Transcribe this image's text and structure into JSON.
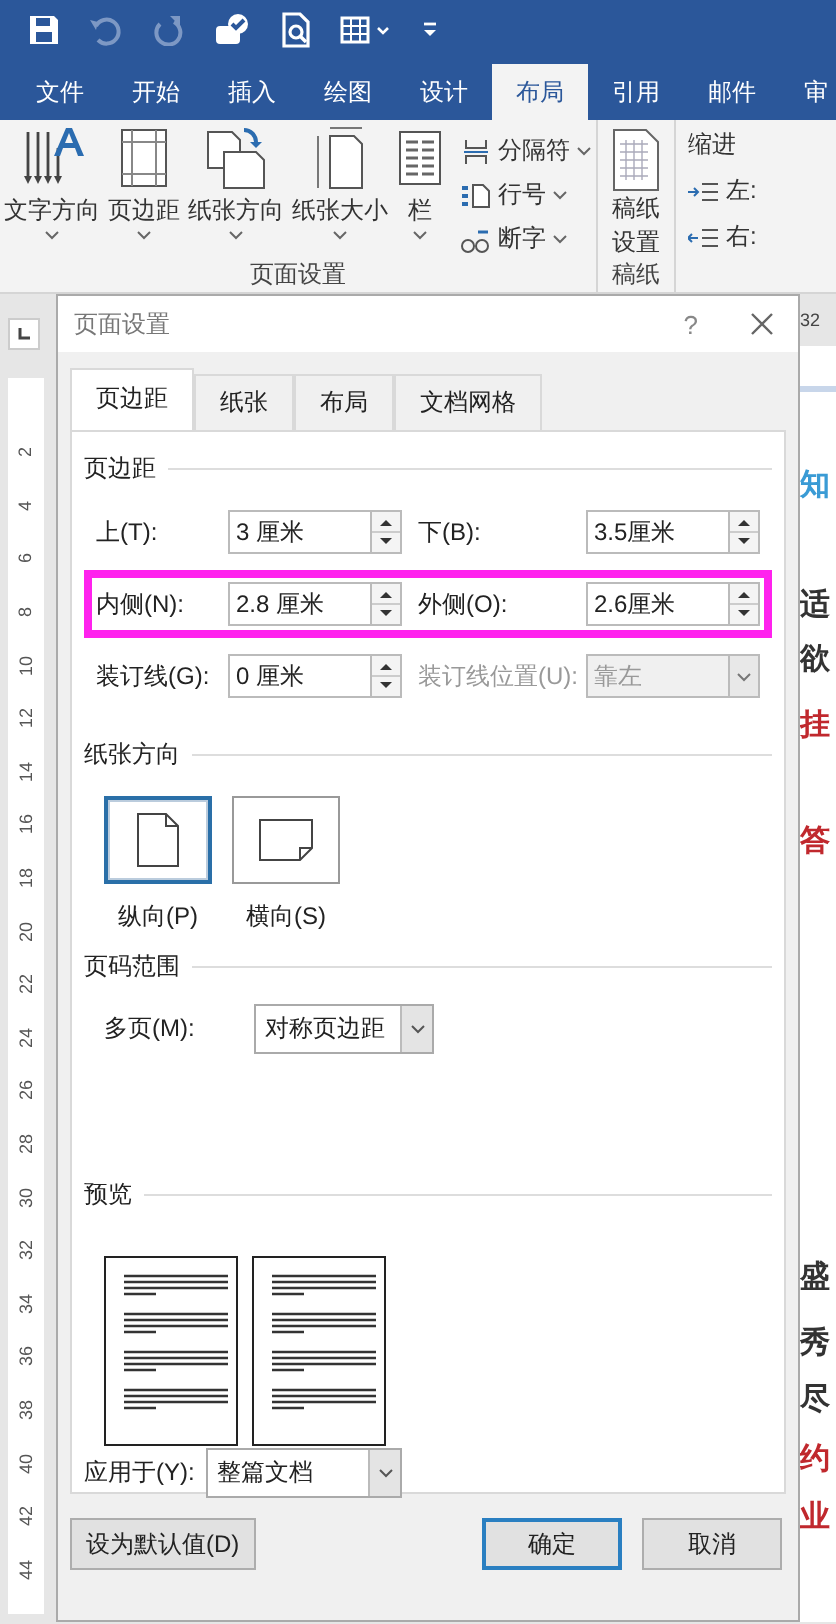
{
  "quick_access": [
    {
      "kind": "save",
      "disabled": false
    },
    {
      "kind": "undo",
      "disabled": true
    },
    {
      "kind": "redo",
      "disabled": true
    },
    {
      "kind": "touch",
      "disabled": false
    },
    {
      "kind": "preview",
      "disabled": false
    },
    {
      "kind": "table",
      "disabled": false
    },
    {
      "kind": "customize",
      "disabled": false
    }
  ],
  "ribbon_tabs": [
    {
      "label": "文件",
      "selected": false
    },
    {
      "label": "开始",
      "selected": false
    },
    {
      "label": "插入",
      "selected": false
    },
    {
      "label": "绘图",
      "selected": false
    },
    {
      "label": "设计",
      "selected": false
    },
    {
      "label": "布局",
      "selected": true
    },
    {
      "label": "引用",
      "selected": false
    },
    {
      "label": "邮件",
      "selected": false
    },
    {
      "label": "审",
      "selected": false
    }
  ],
  "page_setup_group": {
    "label": "页面设置",
    "large_buttons": [
      {
        "label": "文字方向",
        "kind": "text-direction"
      },
      {
        "label": "页边距",
        "kind": "margins"
      },
      {
        "label": "纸张方向",
        "kind": "orientation"
      },
      {
        "label": "纸张大小",
        "kind": "size"
      },
      {
        "label": "栏",
        "kind": "columns"
      }
    ],
    "small_buttons": [
      {
        "label": "分隔符",
        "kind": "breaks"
      },
      {
        "label": "行号",
        "kind": "line-numbers"
      },
      {
        "label": "断字",
        "kind": "hyphenation"
      }
    ]
  },
  "manuscript_group": {
    "button_lines": [
      "稿纸",
      "设置"
    ],
    "label": "稿纸"
  },
  "indent_group": {
    "title": "缩进",
    "items": [
      {
        "label": "左:",
        "kind": "left"
      },
      {
        "label": "右:",
        "kind": "right"
      }
    ]
  },
  "ruler": {
    "labels": [
      "2",
      "4",
      "6",
      "8",
      "10",
      "12",
      "14",
      "16",
      "18",
      "20",
      "22",
      "24",
      "26",
      "28",
      "30",
      "32",
      "34",
      "36",
      "38",
      "40",
      "42",
      "44"
    ]
  },
  "document": {
    "ruler_label": "32",
    "fragments": [
      {
        "text": "知",
        "color": "#3a9bd5"
      },
      {
        "text": "适",
        "color": "#333333"
      },
      {
        "text": "欲",
        "color": "#333333"
      },
      {
        "text": "挂",
        "color": "#c0282d"
      },
      {
        "text": "答",
        "color": "#c0282d"
      },
      {
        "text": "盛",
        "color": "#333333"
      },
      {
        "text": "秀",
        "color": "#333333"
      },
      {
        "text": "尽",
        "color": "#333333"
      },
      {
        "text": "约",
        "color": "#c0282d"
      },
      {
        "text": "业",
        "color": "#c0282d"
      }
    ]
  },
  "dialog": {
    "title": "页面设置",
    "help": "?",
    "tabs": [
      {
        "label": "页边距",
        "selected": true
      },
      {
        "label": "纸张",
        "selected": false
      },
      {
        "label": "布局",
        "selected": false
      },
      {
        "label": "文档网格",
        "selected": false
      }
    ],
    "margins": {
      "heading": "页边距",
      "rows": [
        {
          "highlighted": false,
          "fields": [
            {
              "kind": "spin",
              "label": "上(T):",
              "value": "3 厘米",
              "disabled": false
            },
            {
              "kind": "spin",
              "label": "下(B):",
              "value": "3.5厘米",
              "disabled": false
            }
          ]
        },
        {
          "highlighted": true,
          "fields": [
            {
              "kind": "spin",
              "label": "内侧(N):",
              "value": "2.8 厘米",
              "disabled": false
            },
            {
              "kind": "spin",
              "label": "外侧(O):",
              "value": "2.6厘米",
              "disabled": false
            }
          ]
        },
        {
          "highlighted": false,
          "fields": [
            {
              "kind": "spin",
              "label": "装订线(G):",
              "value": "0 厘米",
              "disabled": false
            },
            {
              "kind": "dropdown",
              "label": "装订线位置(U):",
              "value": "靠左",
              "disabled": true
            }
          ]
        }
      ]
    },
    "orientation": {
      "heading": "纸张方向",
      "options": [
        {
          "label": "纵向(P)",
          "kind": "portrait",
          "selected": true
        },
        {
          "label": "横向(S)",
          "kind": "landscape",
          "selected": false
        }
      ]
    },
    "pages": {
      "heading": "页码范围",
      "label": "多页(M):",
      "value": "对称页边距"
    },
    "preview": {
      "heading": "预览"
    },
    "apply": {
      "label": "应用于(Y):",
      "value": "整篇文档"
    },
    "buttons": [
      {
        "label": "设为默认值(D)",
        "kind": "default"
      },
      {
        "label": "确定",
        "kind": "primary"
      },
      {
        "label": "取消",
        "kind": "normal"
      }
    ]
  }
}
